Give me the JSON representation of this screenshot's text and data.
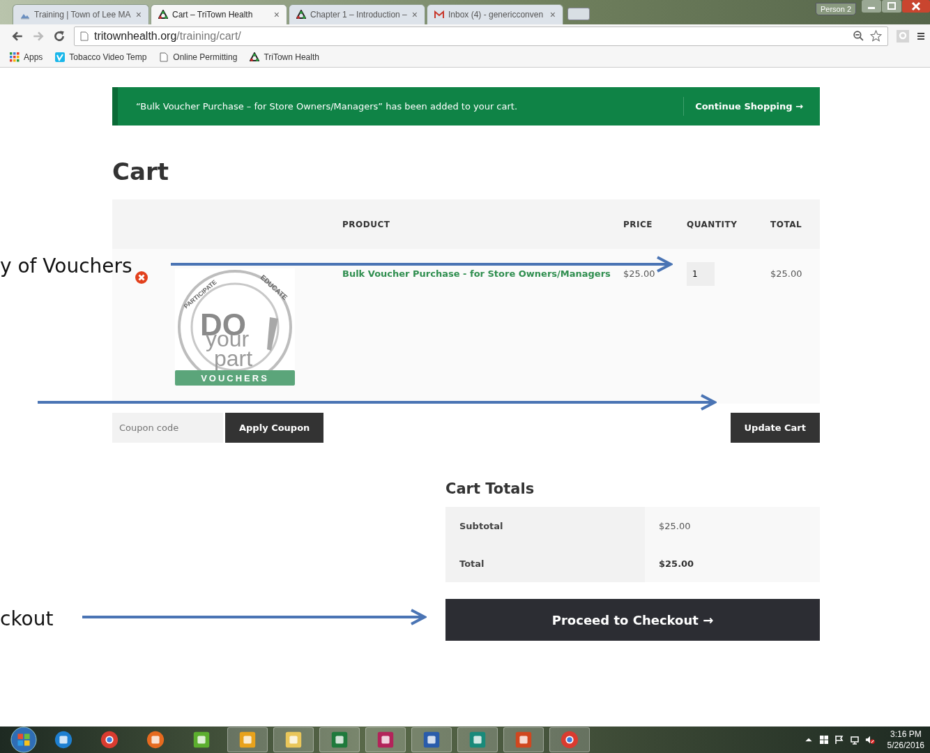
{
  "browser": {
    "tabs": [
      {
        "title": "Training | Town of Lee MA",
        "selected": false,
        "close": "×"
      },
      {
        "title": "Cart – TriTown Health",
        "selected": true,
        "close": "×"
      },
      {
        "title": "Chapter 1 – Introduction –",
        "selected": false,
        "close": "×"
      },
      {
        "title": "Inbox (4) - genericconven",
        "selected": false,
        "close": "×"
      }
    ],
    "profile": "Person 2",
    "address": {
      "host": "tritownhealth.org",
      "path": "/training/cart/"
    },
    "bookmarks": [
      {
        "label": "Apps"
      },
      {
        "label": "Tobacco Video Temp"
      },
      {
        "label": "Online Permitting"
      },
      {
        "label": "TriTown Health"
      }
    ]
  },
  "notice": {
    "message": "“Bulk Voucher Purchase – for Store Owners/Managers” has been added to your cart.",
    "link": "Continue Shopping",
    "arrow": "→"
  },
  "page_title": "Cart",
  "table": {
    "columns": [
      "PRODUCT",
      "PRICE",
      "QUANTITY",
      "TOTAL"
    ],
    "rows": [
      {
        "product": "Bulk Voucher Purchase - for Store Owners/Managers",
        "price": "$25.00",
        "quantity": "1",
        "total": "$25.00",
        "image": {
          "ring": [
            "PARTICIPATE",
            "EDUCATE"
          ],
          "words": [
            "DO",
            "your",
            "part"
          ],
          "banner": "VOUCHERS"
        }
      }
    ]
  },
  "coupon": {
    "placeholder": "Coupon code",
    "apply": "Apply Coupon"
  },
  "update_button": "Update Cart",
  "totals": {
    "title": "Cart Totals",
    "rows": [
      {
        "label": "Subtotal",
        "value": "$25.00",
        "strong": false
      },
      {
        "label": "Total",
        "value": "$25.00",
        "strong": true
      }
    ]
  },
  "checkout": {
    "label": "Proceed to Checkout",
    "arrow": "→"
  },
  "annotations": [
    "y of Vouchers",
    "ckout"
  ],
  "taskbar": {
    "apps": [
      {
        "kind": "ie",
        "open": false
      },
      {
        "kind": "chrome",
        "open": false
      },
      {
        "kind": "firefox",
        "open": false
      },
      {
        "kind": "green",
        "open": false
      },
      {
        "kind": "outlook",
        "open": true
      },
      {
        "kind": "explorer",
        "open": true
      },
      {
        "kind": "excel",
        "open": true
      },
      {
        "kind": "access",
        "open": true
      },
      {
        "kind": "word",
        "open": true
      },
      {
        "kind": "publisher",
        "open": true
      },
      {
        "kind": "powerpoint",
        "open": true
      },
      {
        "kind": "chrome",
        "open": true
      }
    ],
    "time": "3:16 PM",
    "date": "5/26/2016"
  }
}
